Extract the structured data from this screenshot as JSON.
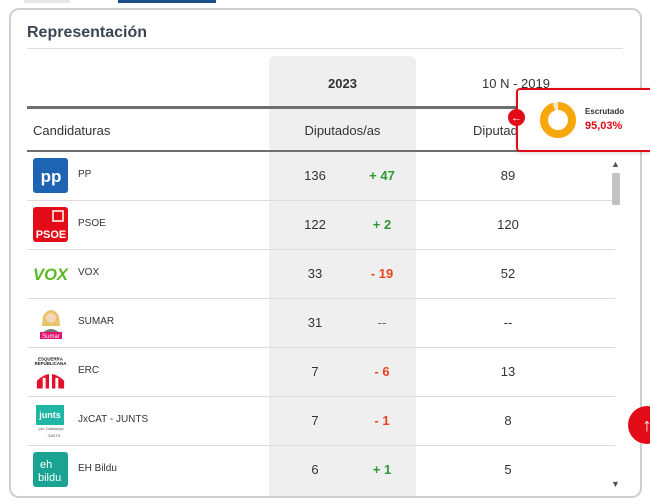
{
  "section_title": "Representación",
  "columns": {
    "year_current": "2023",
    "year_previous": "10 N - 2019",
    "candidaturas": "Candidaturas",
    "diputados": "Diputados/as",
    "diputados_prev_truncated": "Diputad"
  },
  "rows": [
    {
      "name": "PP",
      "logo_text": "pp",
      "logo_color": "#1d64b4",
      "seats": "136",
      "diff": "+ 47",
      "diff_type": "pos",
      "prev": "89"
    },
    {
      "name": "PSOE",
      "logo_text": "PSOE",
      "logo_color": "#e30b17",
      "seats": "122",
      "diff": "+ 2",
      "diff_type": "pos",
      "prev": "120"
    },
    {
      "name": "VOX",
      "logo_text": "VOX",
      "logo_color": "#5bb923",
      "seats": "33",
      "diff": "- 19",
      "diff_type": "neg",
      "prev": "52"
    },
    {
      "name": "SUMAR",
      "logo_text": "Sumar",
      "logo_color": "#e5106f",
      "seats": "31",
      "diff": "--",
      "diff_type": "none",
      "prev": "--"
    },
    {
      "name": "ERC",
      "logo_text": "ESQUERRA REPUBLICANA",
      "logo_color": "#e3102b",
      "seats": "7",
      "diff": "- 6",
      "diff_type": "neg",
      "prev": "13"
    },
    {
      "name": "JxCAT - JUNTS",
      "logo_text": "junts",
      "logo_color": "#1fb6a6",
      "seats": "7",
      "diff": "- 1",
      "diff_type": "neg",
      "prev": "8"
    },
    {
      "name": "EH Bildu",
      "logo_text": "eh bildu",
      "logo_color": "#1aa392",
      "seats": "6",
      "diff": "+ 1",
      "diff_type": "pos",
      "prev": "5"
    }
  ],
  "popup": {
    "label": "Escrutado",
    "value": "95,03%",
    "fraction": 0.9503,
    "color": "#f7a70a"
  },
  "colors": {
    "accent": "#e30b17",
    "positive": "#2f9a2f",
    "negative": "#e8441f"
  },
  "icons": {
    "popup_arrow": "arrow-left-icon",
    "fab": "arrow-up-icon",
    "scroll_up": "chevron-up-icon",
    "scroll_down": "chevron-down-icon"
  }
}
